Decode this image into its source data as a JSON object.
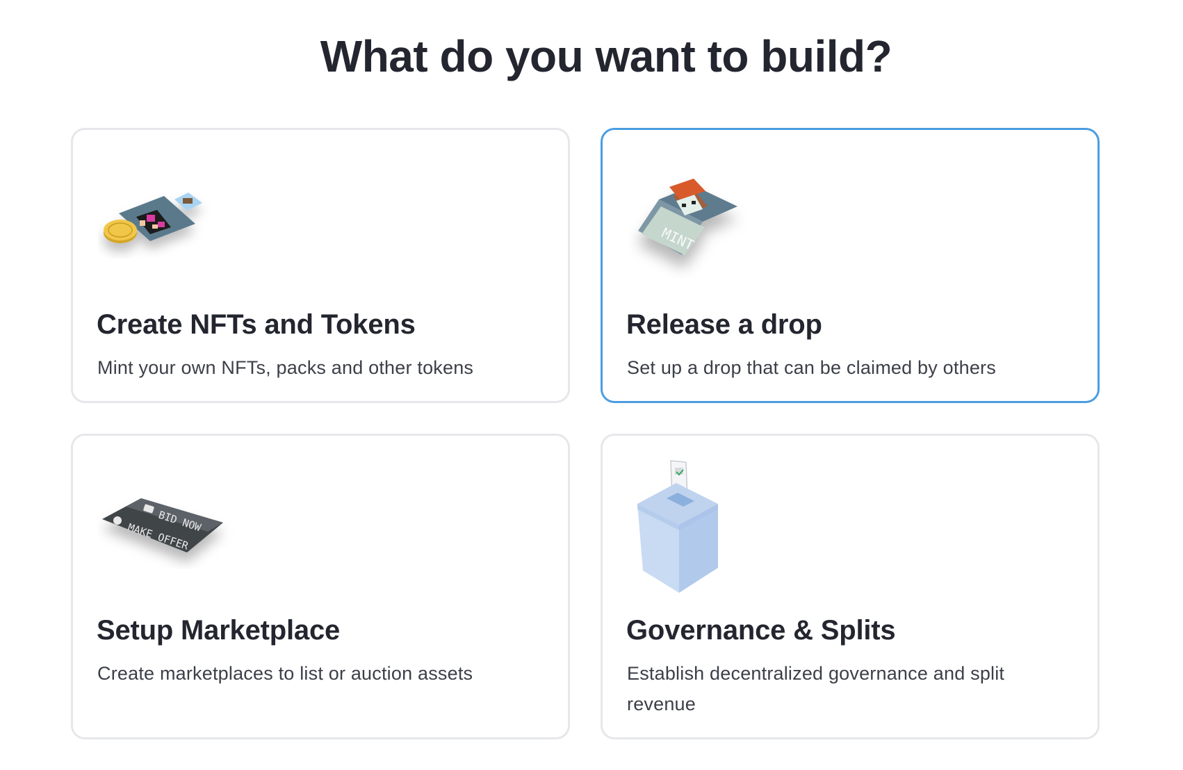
{
  "page": {
    "title": "What do you want to build?"
  },
  "options": [
    {
      "title": "Create NFTs and Tokens",
      "description": "Mint your own NFTs, packs and other tokens",
      "icon": "nft-tokens-icon",
      "selected": false
    },
    {
      "title": "Release a drop",
      "description": "Set up a drop that can be claimed by others",
      "icon": "mint-drop-icon",
      "selected": true
    },
    {
      "title": "Setup Marketplace",
      "description": "Create marketplaces to list or auction assets",
      "icon": "marketplace-icon",
      "art_text": [
        "BID NOW",
        "MAKE OFFER"
      ],
      "selected": false
    },
    {
      "title": "Governance & Splits",
      "description": "Establish decentralized governance and split revenue",
      "icon": "ballot-box-icon",
      "selected": false
    }
  ],
  "art": {
    "mint_label": "MINT"
  },
  "colors": {
    "selected_border": "#4a9de0",
    "card_border": "#e6e7ea",
    "title": "#23262f"
  }
}
